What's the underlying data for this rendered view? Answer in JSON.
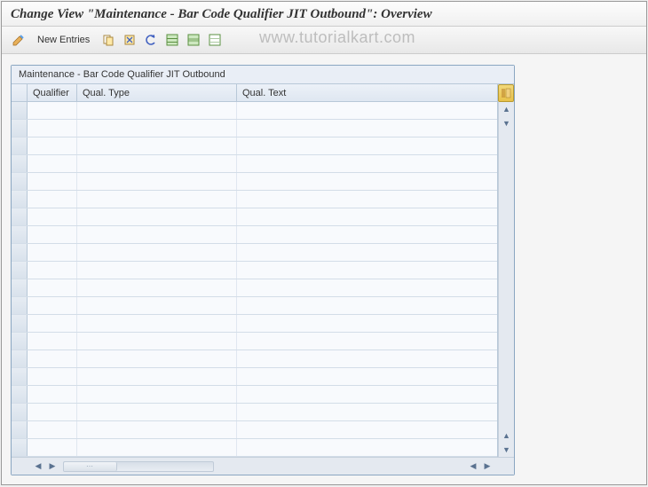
{
  "title": "Change View \"Maintenance - Bar Code Qualifier JIT Outbound\": Overview",
  "watermark": "www.tutorialkart.com",
  "toolbar": {
    "new_entries_label": "New Entries"
  },
  "panel": {
    "title": "Maintenance - Bar Code Qualifier JIT Outbound",
    "columns": {
      "qualifier": "Qualifier",
      "qual_type": "Qual. Type",
      "qual_text": "Qual. Text"
    },
    "row_count": 20,
    "rows": []
  }
}
